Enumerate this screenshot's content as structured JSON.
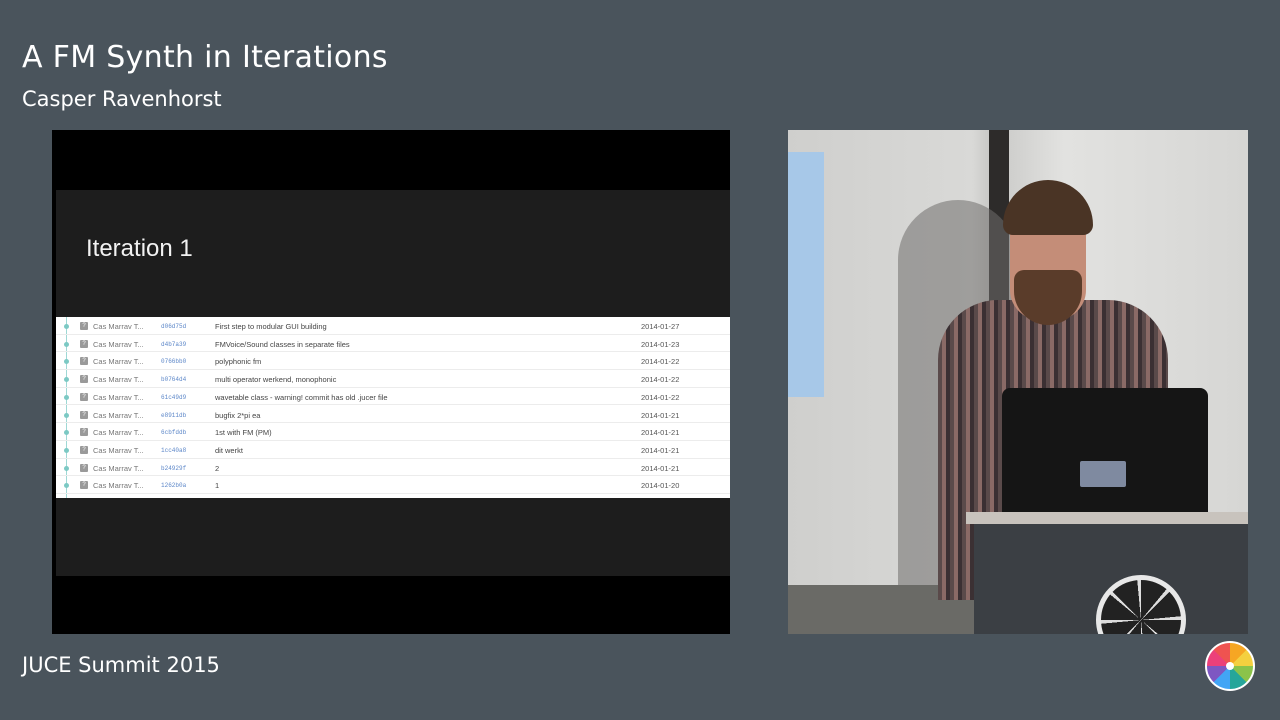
{
  "talk": {
    "title": "A FM Synth in Iterations",
    "speaker": "Casper Ravenhorst",
    "event": "JUCE Summit 2015"
  },
  "slide": {
    "heading": "Iteration 1",
    "commits": [
      {
        "author": "Cas Marrav T...",
        "hash": "d06d75d",
        "message": "First step to modular GUI building",
        "date": "2014-01-27"
      },
      {
        "author": "Cas Marrav T...",
        "hash": "d4b7a39",
        "message": "FMVoice/Sound classes in separate files",
        "date": "2014-01-23"
      },
      {
        "author": "Cas Marrav T...",
        "hash": "0766bb0",
        "message": "polyphonic fm",
        "date": "2014-01-22"
      },
      {
        "author": "Cas Marrav T...",
        "hash": "b0764d4",
        "message": "multi operator werkend, monophonic",
        "date": "2014-01-22"
      },
      {
        "author": "Cas Marrav T...",
        "hash": "61c49d9",
        "message": "wavetable class - warning! commit has old .jucer file",
        "date": "2014-01-22"
      },
      {
        "author": "Cas Marrav T...",
        "hash": "e8911db",
        "message": "bugfix 2*pi ea",
        "date": "2014-01-21"
      },
      {
        "author": "Cas Marrav T...",
        "hash": "6cbfddb",
        "message": "1st with FM (PM)",
        "date": "2014-01-21"
      },
      {
        "author": "Cas Marrav T...",
        "hash": "1cc40a8",
        "message": "dit werkt",
        "date": "2014-01-21"
      },
      {
        "author": "Cas Marrav T...",
        "hash": "b24929f",
        "message": "2",
        "date": "2014-01-21"
      },
      {
        "author": "Cas Marrav T...",
        "hash": "1262b0a",
        "message": "1",
        "date": "2014-01-20"
      }
    ]
  },
  "icons": {
    "author_avatar": "question-mark-avatar-icon",
    "logo": "juce-logo-icon"
  },
  "colors": {
    "background": "#4a545c",
    "hash_link": "#5b86c8",
    "graph_line": "#9fd8d5"
  }
}
